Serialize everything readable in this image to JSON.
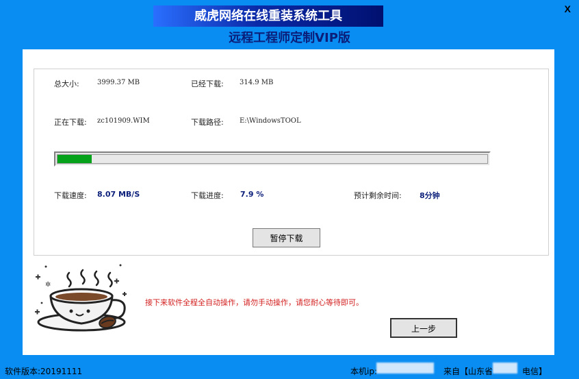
{
  "window": {
    "title": "威虎网络在线重装系统工具",
    "subtitle": "远程工程师定制VIP版",
    "close_label": "X"
  },
  "info": {
    "total_size_label": "总大小:",
    "total_size_value": "3999.37 MB",
    "downloaded_label": "已经下载:",
    "downloaded_value": "314.9 MB",
    "downloading_label": "正在下载:",
    "downloading_value": "zc101909.WIM",
    "path_label": "下载路径:",
    "path_value": "E:\\WindowsTOOL"
  },
  "progress": {
    "percent": 7.9,
    "color": "#06a21c"
  },
  "stats": {
    "speed_label": "下载速度:",
    "speed_value": "8.07 MB/S",
    "progress_label": "下载进度:",
    "progress_value": "7.9 %",
    "remaining_label": "预计剩余时间:",
    "remaining_value": "8分钟"
  },
  "buttons": {
    "pause": "暂停下载",
    "back": "上一步"
  },
  "notice": "接下来软件全程全自动操作，请勿手动操作，请您耐心等待即可。",
  "footer": {
    "version": "软件版本:20191111",
    "ip_label": "本机ip:",
    "from_label": "来自【山东省",
    "isp_label": "电信】"
  },
  "colors": {
    "background": "#0a8df2",
    "title_navy": "#0b1e7a",
    "notice_red": "#d31f1f"
  },
  "icons": [
    "close-icon",
    "coffee-cup-illustration"
  ]
}
